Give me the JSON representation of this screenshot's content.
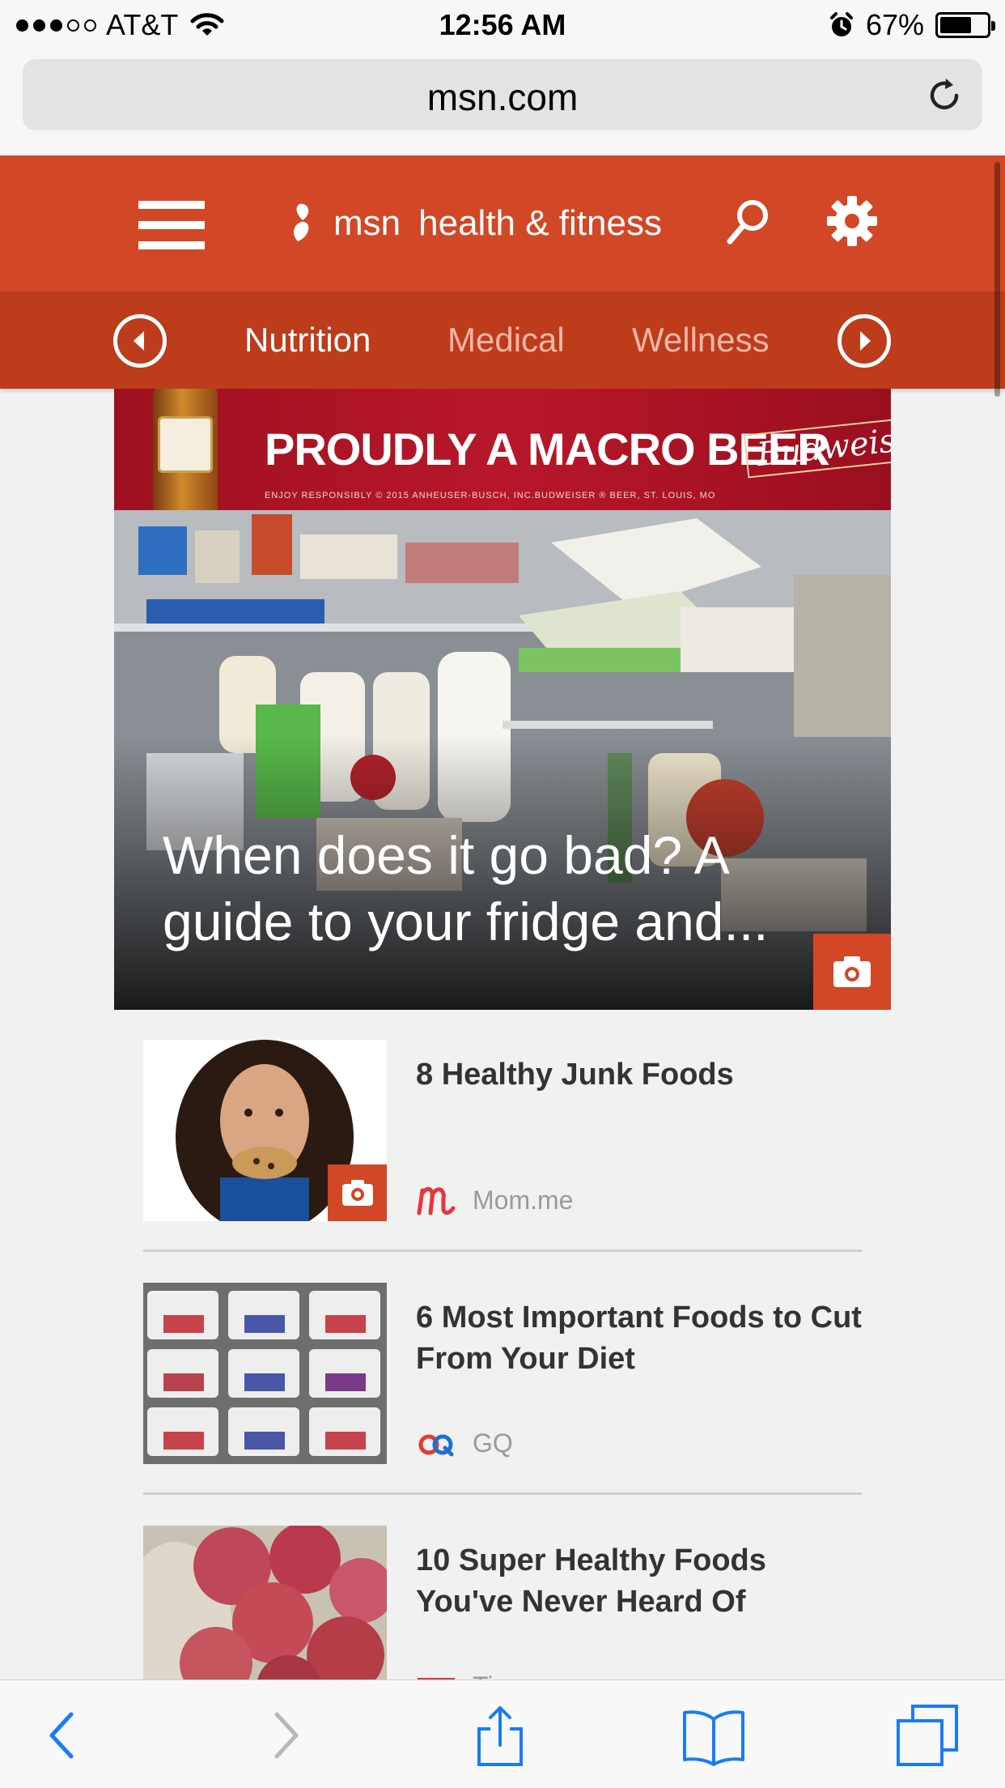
{
  "status_bar": {
    "carrier": "AT&T",
    "time": "12:56 AM",
    "battery": "67%",
    "battery_level": 0.67,
    "signal_bars_filled": 3,
    "signal_bars_total": 5
  },
  "browser": {
    "url": "msn.com",
    "reload_icon": "reload-icon"
  },
  "header": {
    "brand": "msn",
    "section": "health & fitness",
    "menu_icon": "hamburger-icon",
    "search_icon": "search-icon",
    "settings_icon": "gear-icon",
    "accent_color": "#d24726"
  },
  "subnav": {
    "tabs": [
      {
        "label": "Nutrition",
        "active": true
      },
      {
        "label": "Medical",
        "active": false
      },
      {
        "label": "Wellness",
        "active": false
      }
    ],
    "prev_icon": "chevron-left-circle-icon",
    "next_icon": "chevron-right-circle-icon"
  },
  "ad": {
    "headline": "PROUDLY A MACRO BEER",
    "brand": "Budweiser",
    "fine_print": "ENJOY RESPONSIBLY © 2015 ANHEUSER-BUSCH, INC.BUDWEISER ® BEER, ST. LOUIS, MO"
  },
  "hero": {
    "title": "When does it go bad? A guide to your fridge and...",
    "badge_icon": "camera-icon"
  },
  "articles": [
    {
      "headline": "8 Healthy Junk Foods",
      "source": "Mom.me",
      "gallery": true
    },
    {
      "headline": "6 Most Important Foods to Cut From Your Diet",
      "source": "GQ",
      "gallery": false
    },
    {
      "headline": "10 Super Healthy Foods You've Never Heard Of",
      "source": "Time",
      "gallery": false
    }
  ],
  "toolbar": {
    "items": [
      "back-icon",
      "forward-icon",
      "share-icon",
      "bookmarks-icon",
      "tabs-icon"
    ]
  }
}
